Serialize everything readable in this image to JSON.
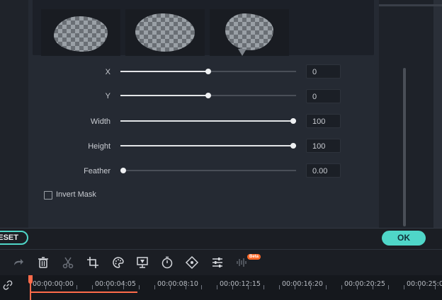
{
  "mask_shapes": [
    {
      "name": "cloud-jagged-shape"
    },
    {
      "name": "cloud-shape"
    },
    {
      "name": "speech-bubble-shape"
    }
  ],
  "properties": [
    {
      "label": "X",
      "value": "0",
      "position": 0.5
    },
    {
      "label": "Y",
      "value": "0",
      "position": 0.5
    },
    {
      "label": "Width",
      "value": "100",
      "position": 1.0
    },
    {
      "label": "Height",
      "value": "100",
      "position": 1.0
    },
    {
      "label": "Feather",
      "value": "0.00",
      "position": 0.0
    }
  ],
  "invert_mask": {
    "label": "Invert Mask",
    "checked": false
  },
  "buttons": {
    "reset": "RESET",
    "ok": "OK"
  },
  "toolbar": {
    "icons": [
      "redo-icon",
      "delete-icon",
      "cut-icon",
      "crop-icon",
      "color-icon",
      "green-screen-icon",
      "speed-icon",
      "keyframe-icon",
      "adjust-icon",
      "audio-icon"
    ],
    "beta_badge": "Beta"
  },
  "timeline": {
    "timestamps": [
      "00:00:00:00",
      "00:00:04:05",
      "00:00:08:10",
      "00:00:12:15",
      "00:00:16:20",
      "00:00:20:25",
      "00:00:25:0"
    ]
  },
  "colors": {
    "accent": "#4fd6c8",
    "playhead": "#ff6b4a",
    "beta": "#ff6a2a"
  }
}
